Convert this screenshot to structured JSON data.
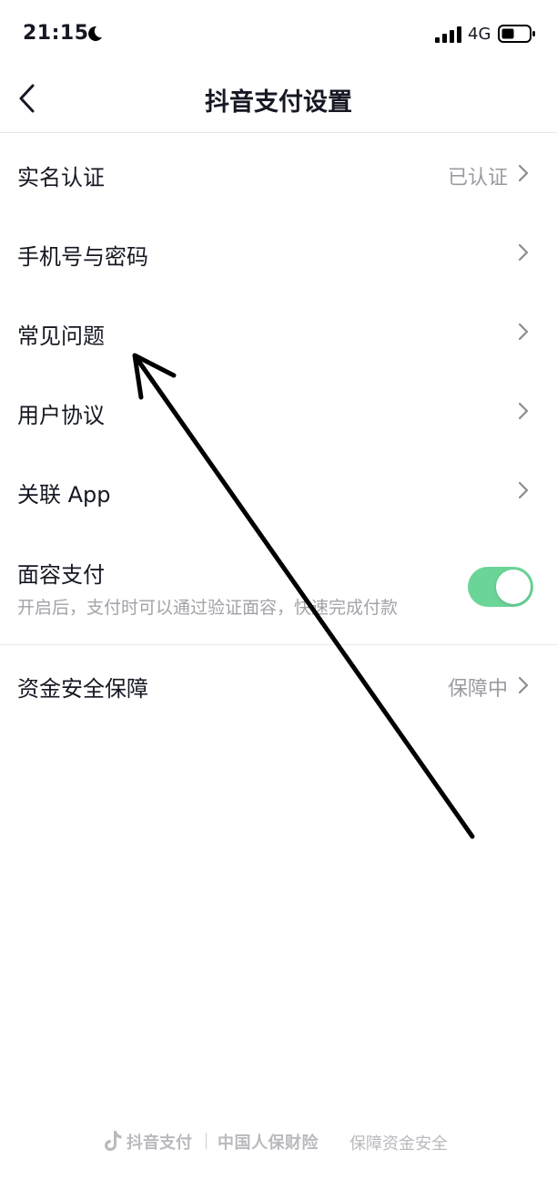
{
  "status_bar": {
    "time": "21:15",
    "network": "4G",
    "icons": [
      "moon-icon",
      "signal-icon",
      "battery-icon"
    ]
  },
  "header": {
    "title": "抖音支付设置",
    "back_icon": "chevron-left-icon"
  },
  "settings": {
    "real_name": {
      "label": "实名认证",
      "value": "已认证"
    },
    "phone_password": {
      "label": "手机号与密码"
    },
    "faq": {
      "label": "常见问题"
    },
    "user_agreement": {
      "label": "用户协议"
    },
    "linked_app": {
      "label": "关联 App"
    },
    "face_pay": {
      "label": "面容支付",
      "description": "开启后，支付时可以通过验证面容，快速完成付款",
      "enabled": true
    },
    "fund_security": {
      "label": "资金安全保障",
      "value": "保障中"
    }
  },
  "footer": {
    "brand": "抖音支付",
    "partner": "中国人保财险",
    "slogan": "保障资金安全"
  },
  "colors": {
    "toggle_on": "#6bd598",
    "secondary_text": "#9a9ba1",
    "primary_text": "#161823"
  }
}
